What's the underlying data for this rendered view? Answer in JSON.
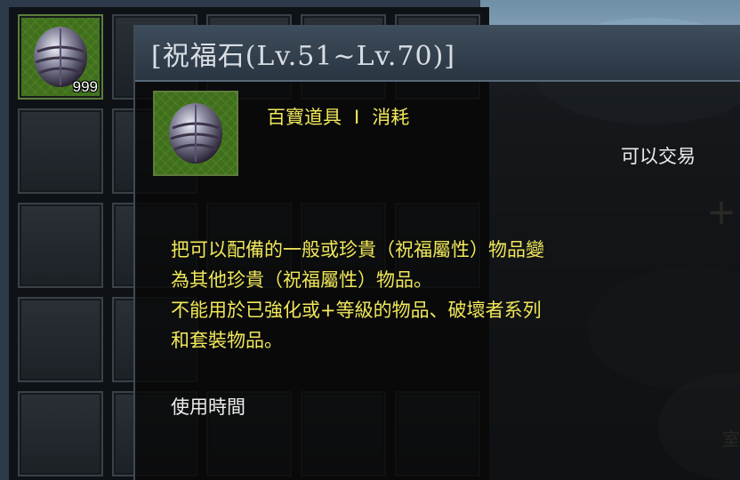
{
  "item": {
    "title": "[祝福石(Lv.51~Lv.70)]",
    "stack_count": "999",
    "category": "百寶道具",
    "category_separator": "I",
    "subcategory": "消耗",
    "trade_status": "可以交易",
    "description_lines": [
      "把可以配備的一般或珍貴（祝福屬性）物品變",
      "為其他珍貴（祝福屬性）物品。",
      "不能用於已強化或+等級的物品、破壞者系列",
      "和套裝物品。"
    ],
    "usage_time_label": "使用時間"
  },
  "scene": {
    "plus_glyph": "+",
    "edge_text": "室"
  },
  "colors": {
    "yellow_text": "#f1e85a",
    "white_text": "#ececec",
    "slot_green": "#3f6e1d"
  }
}
